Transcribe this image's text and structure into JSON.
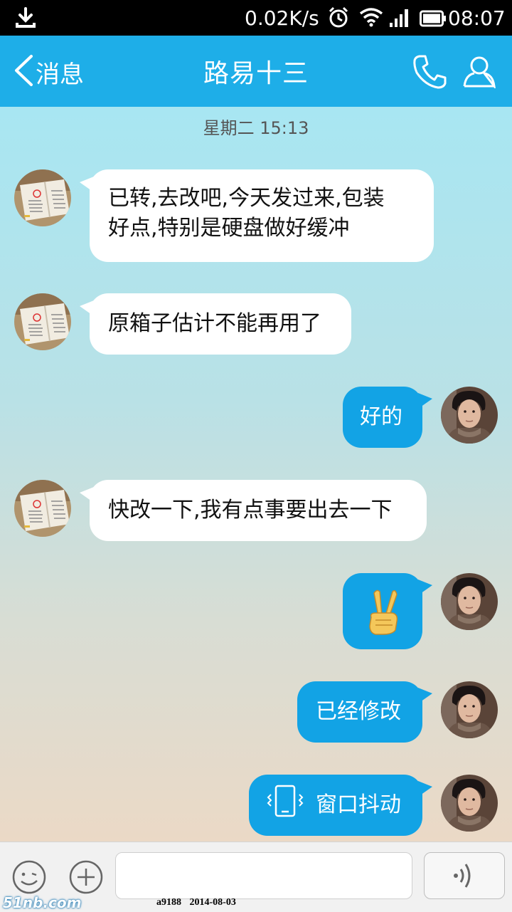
{
  "status_bar": {
    "net_speed": "0.02K/s",
    "time": "08:07",
    "icons": [
      "download-icon",
      "alarm-icon",
      "wifi-icon",
      "signal-icon",
      "battery-icon"
    ]
  },
  "header": {
    "back_label": "消息",
    "title": "路易十三",
    "color": "#1eaee8"
  },
  "chat": {
    "date_label": "星期二 15:13",
    "messages": [
      {
        "from": "contact",
        "line1": "已转,去改吧,今天发过来,包装",
        "line2": "好点,特别是硬盘做好缓冲"
      },
      {
        "from": "contact",
        "text": "原箱子估计不能再用了"
      },
      {
        "from": "me",
        "text": "好的"
      },
      {
        "from": "contact",
        "text": "快改一下,我有点事要出去一下"
      },
      {
        "from": "me",
        "emoji": "✌"
      },
      {
        "from": "me",
        "text": "已经修改"
      },
      {
        "from": "me",
        "text": "窗口抖动",
        "icon": "vibrate-icon"
      }
    ],
    "out_bubble_color": "#12a3e5",
    "in_bubble_color": "#ffffff"
  },
  "input": {
    "value": "",
    "placeholder": ""
  },
  "watermark": {
    "logo": "51nb.com",
    "text": "a9188 2014-08-03"
  }
}
